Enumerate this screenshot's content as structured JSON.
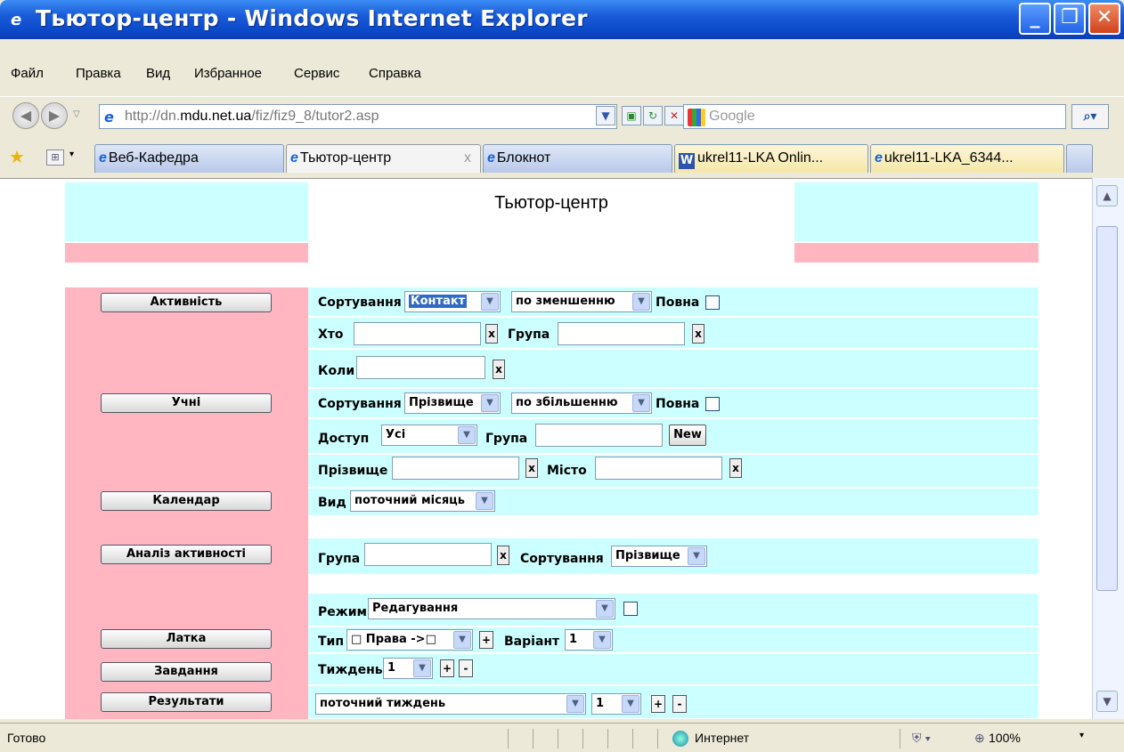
{
  "window": {
    "title": "Тьютор-центр - Windows Internet Explorer",
    "min": "_",
    "max": "❐",
    "close": "✕"
  },
  "menu": [
    "Файл",
    "Правка",
    "Вид",
    "Избранное",
    "Сервис",
    "Справка"
  ],
  "address": {
    "url_prefix": "http://dn.",
    "url_domain": "mdu.net.ua",
    "url_path": "/fiz/fiz9_8/tutor2.asp",
    "search_placeholder": "Google"
  },
  "tabs": [
    {
      "label": "Веб-Кафедра"
    },
    {
      "label": "Тьютор-центр",
      "active": true
    },
    {
      "label": "Блокнот"
    },
    {
      "label": "ukrel11-LKA Onlin..."
    },
    {
      "label": "ukrel11-LKA_6344..."
    }
  ],
  "page": {
    "title": "Тьютор-центр",
    "nav_buttons": {
      "activity": "Активність",
      "students": "Учні",
      "calendar": "Календар",
      "analysis": "Аналіз активності",
      "patch": "Латка",
      "tasks": "Завдання",
      "results": "Результати"
    },
    "activity": {
      "sort_label": "Сортування",
      "sort_value": "Контакт",
      "order_value": "по зменшенню",
      "full_label": "Повна",
      "who_label": "Хто",
      "group_label": "Група",
      "when_label": "Коли"
    },
    "students": {
      "sort_label": "Сортування",
      "sort_value": "Прізвище",
      "order_value": "по збільшенню",
      "full_label": "Повна",
      "access_label": "Доступ",
      "access_value": "Усі",
      "group_label": "Група",
      "new_button": "New",
      "surname_label": "Прізвище",
      "city_label": "Місто"
    },
    "calendar": {
      "view_label": "Вид",
      "view_value": "поточний місяць"
    },
    "analysis": {
      "group_label": "Група",
      "sort_label": "Сортування",
      "sort_value": "Прізвище"
    },
    "mode": {
      "label": "Режим",
      "value": "Редагування"
    },
    "patch": {
      "type_label": "Тип",
      "type_value": "□ Права ->□",
      "variant_label": "Варіант",
      "variant_value": "1"
    },
    "tasks": {
      "week_label": "Тиждень",
      "week_value": "1"
    },
    "results": {
      "period_value": "поточний тиждень",
      "num_value": "1"
    },
    "x_glyph": "x",
    "plus_glyph": "+",
    "minus_glyph": "-",
    "arrow_glyph": "▼"
  },
  "status": {
    "left": "Готово",
    "zone": "Интернет",
    "zoom": "100%"
  }
}
